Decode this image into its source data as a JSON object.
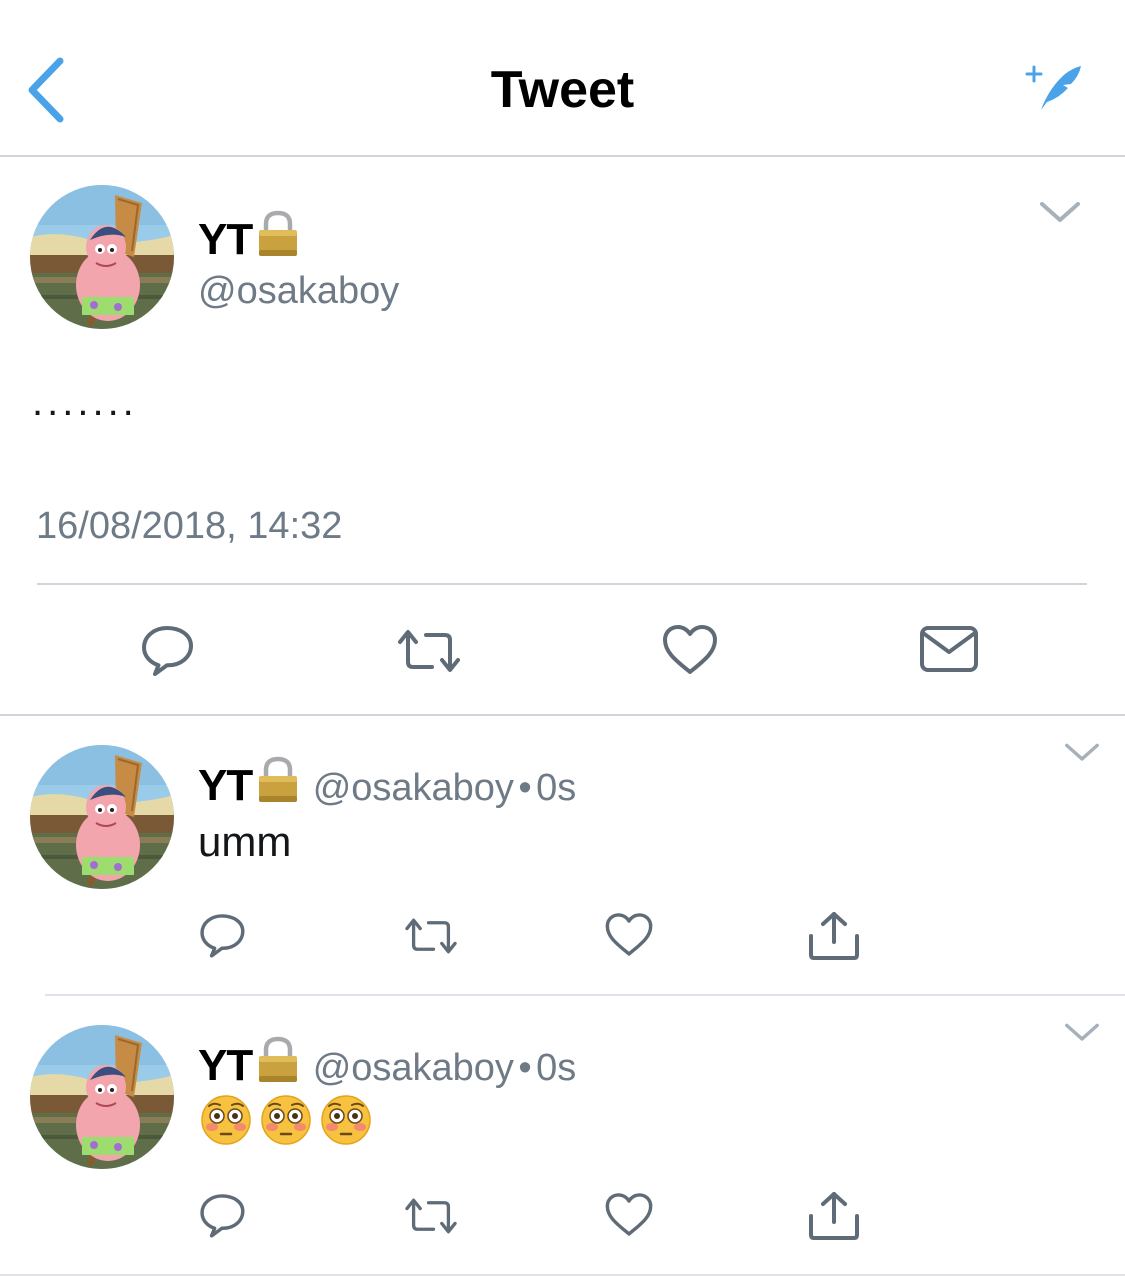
{
  "header": {
    "title": "Tweet"
  },
  "main_tweet": {
    "name": "YT",
    "handle": "@osakaboy",
    "text": ".......",
    "timestamp": "16/08/2018, 14:32"
  },
  "replies": [
    {
      "name": "YT",
      "handle": "@osakaboy",
      "separator": "•",
      "time": "0s",
      "text": "umm"
    },
    {
      "name": "YT",
      "handle": "@osakaboy",
      "separator": "•",
      "time": "0s",
      "text": "😳😳😳"
    }
  ],
  "colors": {
    "accent": "#4aa3e8",
    "icon": "#5f6b77",
    "divider": "#cfd5da",
    "text_muted": "#6e7a86"
  },
  "icons": {
    "back": "chevron-left-icon",
    "compose": "compose-icon",
    "caret": "chevron-down-icon",
    "reply": "reply-icon",
    "retweet": "retweet-icon",
    "like": "heart-icon",
    "dm": "envelope-icon",
    "share": "share-icon",
    "lock": "lock-icon"
  }
}
